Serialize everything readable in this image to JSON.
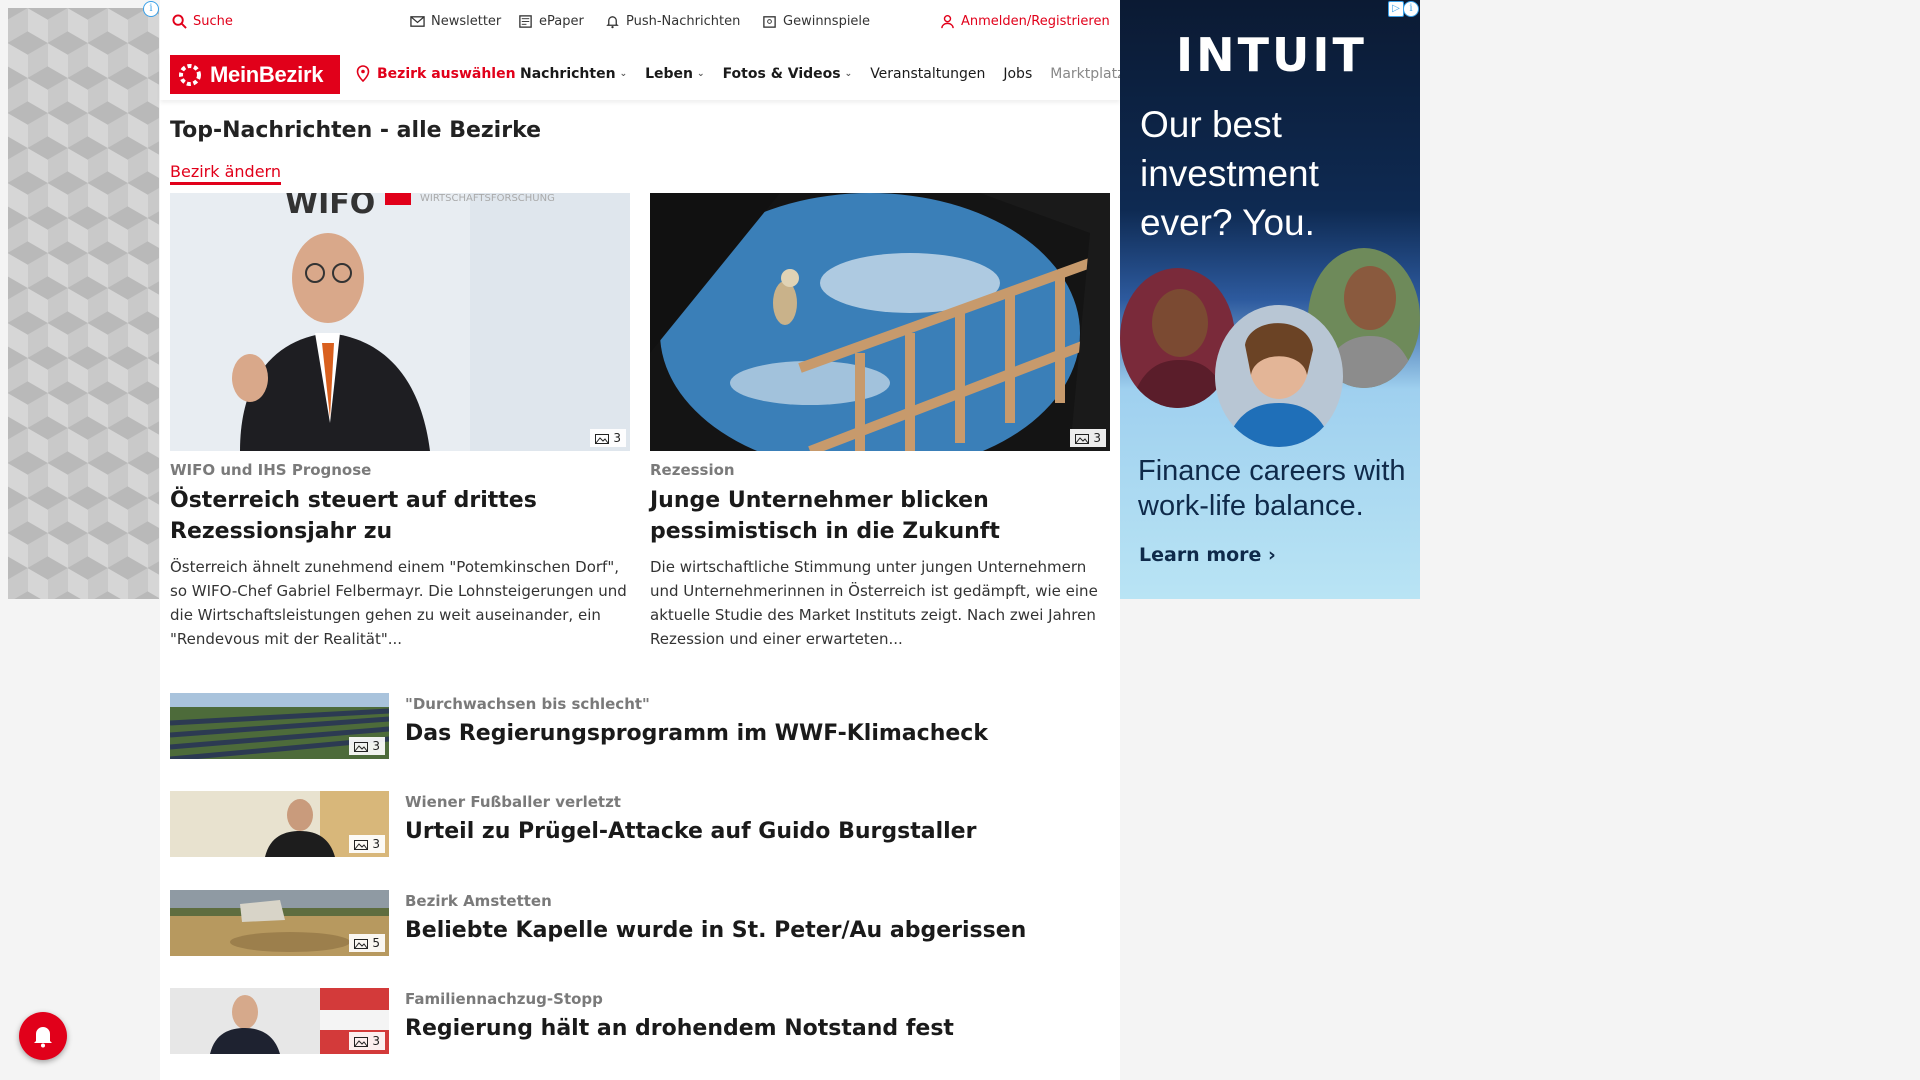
{
  "topbar": {
    "search": "Suche",
    "newsletter": "Newsletter",
    "epaper": "ePaper",
    "push": "Push-Nachrichten",
    "games": "Gewinnspiele",
    "login": "Anmelden/Registrieren"
  },
  "nav": {
    "logo": "MeinBezirk",
    "select_district": "Bezirk auswählen",
    "links": [
      {
        "label": "Nachrichten",
        "dropdown": true
      },
      {
        "label": "Leben",
        "dropdown": true
      },
      {
        "label": "Fotos & Videos",
        "dropdown": true
      },
      {
        "label": "Veranstaltungen",
        "dropdown": false
      },
      {
        "label": "Jobs",
        "dropdown": false
      },
      {
        "label": "Marktplatz",
        "dropdown": false
      }
    ]
  },
  "page": {
    "title": "Top-Nachrichten - alle Bezirke",
    "change_district": "Bezirk ändern"
  },
  "featured": [
    {
      "kicker": "WIFO und IHS Prognose",
      "headline": "Österreich steuert auf drittes Rezessionsjahr zu",
      "teaser": "Österreich ähnelt zunehmend einem \"Potemkinschen Dorf\", so WIFO-Chef Gabriel Felbermayr. Die Lohnsteigerungen und die Wirtschaftsleistungen gehen zu weit auseinander, ein \"Rendevous mit der Realität\"...",
      "photos": "3",
      "image_text": "WIFO"
    },
    {
      "kicker": "Rezession",
      "headline": "Junge Unternehmer blicken pessimistisch in die Zukunft",
      "teaser": "Die wirtschaftliche Stimmung unter jungen Unternehmern und Unternehmerinnen in Österreich ist gedämpft, wie eine aktuelle Studie des Market Instituts zeigt. Nach zwei Jahren Rezession und einer erwarteten...",
      "photos": "3"
    }
  ],
  "list": [
    {
      "kicker": "\"Durchwachsen bis schlecht\"",
      "headline": "Das Regierungsprogramm im WWF-Klimacheck",
      "photos": "3"
    },
    {
      "kicker": "Wiener Fußballer verletzt",
      "headline": "Urteil zu Prügel-Attacke auf Guido Burgstaller",
      "photos": "3"
    },
    {
      "kicker": "Bezirk Amstetten",
      "headline": "Beliebte Kapelle wurde in St. Peter/Au abgerissen",
      "photos": "5"
    },
    {
      "kicker": "Familiennachzug-Stopp",
      "headline": "Regierung hält an drohendem Notstand fest",
      "photos": "3"
    }
  ],
  "ad": {
    "brand": "INTUIT",
    "tagline": "Our best investment ever? You.",
    "subline": "Finance careers with work-life balance.",
    "cta": "Learn more ›"
  },
  "colors": {
    "accent": "#e1001a",
    "kicker": "#7a7a7a",
    "ad_dark": "#0b1a33"
  },
  "icons": [
    "search-icon",
    "mail-icon",
    "newspaper-icon",
    "bell-icon",
    "gift-icon",
    "user-icon",
    "location-pin-icon",
    "camera-icon",
    "notification-bell-icon",
    "ad-info-icon"
  ]
}
